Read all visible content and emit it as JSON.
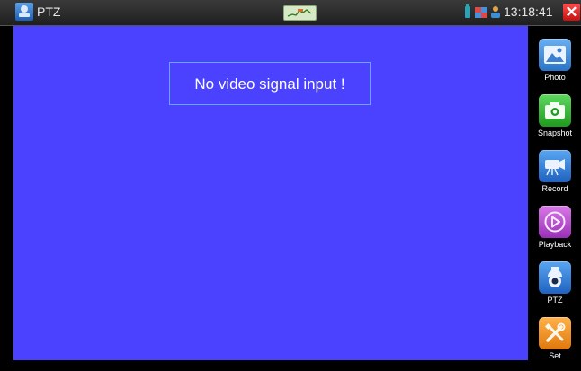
{
  "titlebar": {
    "app_title": "PTZ",
    "app_icon": "ptz-camera-icon",
    "clock": "13:18:41",
    "close_icon": "close-icon"
  },
  "video": {
    "message": "No video signal input  !"
  },
  "sidebar": {
    "items": [
      {
        "label": "Photo",
        "icon": "photo-icon",
        "color": "#3b8fd6"
      },
      {
        "label": "Snapshot",
        "icon": "camera-icon",
        "color": "#2fb12f"
      },
      {
        "label": "Record",
        "icon": "video-camera-icon",
        "color": "#2a78d6"
      },
      {
        "label": "Playback",
        "icon": "play-icon",
        "color": "#b64bd1"
      },
      {
        "label": "PTZ",
        "icon": "ptz-camera-icon",
        "color": "#2a78d6"
      },
      {
        "label": "Set",
        "icon": "tools-icon",
        "color": "#f08a16"
      }
    ]
  },
  "colors": {
    "video_background": "#4b42ff",
    "titlebar": "#2a2a2a",
    "close": "#e01b1b"
  }
}
